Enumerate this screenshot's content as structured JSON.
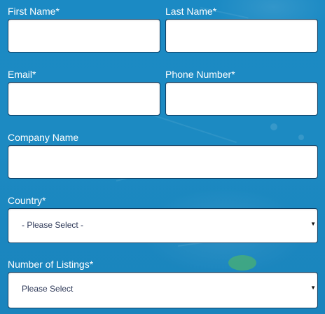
{
  "form": {
    "first_name": {
      "label": "First Name*",
      "value": ""
    },
    "last_name": {
      "label": "Last Name*",
      "value": ""
    },
    "email": {
      "label": "Email*",
      "value": ""
    },
    "phone_number": {
      "label": "Phone Number*",
      "value": ""
    },
    "company_name": {
      "label": "Company Name",
      "value": ""
    },
    "country": {
      "label": "Country*",
      "selected": "- Please Select -"
    },
    "number_of_listings": {
      "label": "Number of Listings*",
      "selected": "Please Select"
    }
  },
  "icons": {
    "dropdown_arrow": "chevron-down-icon"
  },
  "colors": {
    "background": "#1c89c2",
    "field_border": "#0e3e63",
    "field_background": "#ffffff",
    "label_text": "#ffffff",
    "select_text": "#2f3a59"
  }
}
